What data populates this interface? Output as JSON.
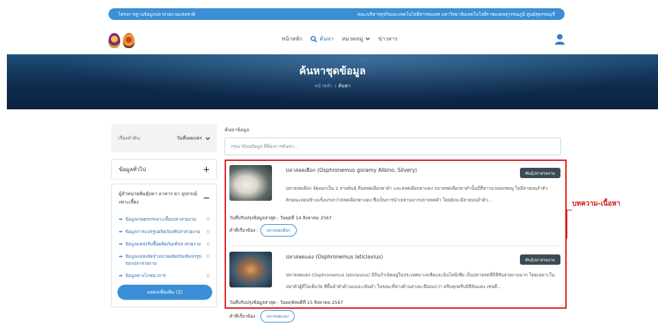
{
  "topbar": {
    "left": "โครงการฐานข้อมูลปลาสวยงามแห่งชาติ",
    "right": "คณะบริหารธุรกิจและเทคโนโลยีสารสนเทศ มหาวิทยาลัยเทคโนโลยีราชมงคลสุวรรณภูมิ ศูนย์สุพรรณบุรี"
  },
  "nav": {
    "home": "หน้าหลัก",
    "search": "ค้นหา",
    "categories": "หมวดหมู่",
    "news": "ข่าวสาร"
  },
  "hero": {
    "title": "ค้นหาชุดข้อมูล",
    "crumb_home": "หน้าหลัก",
    "crumb_sep": "/",
    "crumb_current": "ค้นหา"
  },
  "sidebar": {
    "sort_label": "เรียงลำดับ:",
    "sort_value": "วันที่เผยแพร่",
    "category": "ข้อมูลทั่วไป",
    "category_icon": "plus-icon",
    "supplier_heading": "ผู้จำหน่ายพันธุ์ปลา อาหาร ยา อุปกรณ์เพาะเลี้ยง",
    "links": [
      {
        "label": "ข้อมูลเกษตรกรเพาะเลี้ยงปลาสวยงาม",
        "count": "0"
      },
      {
        "label": "ข้อมูลการแปรรูปผลิตภัณฑ์ปลาสวยงาม",
        "count": "0"
      },
      {
        "label": "ข้อมูลแหล่งรับซื้อผลิตภัณฑ์ปลาสวยงาม",
        "count": "0"
      },
      {
        "label": "ข้อมูลแหล่งจัดจำหน่ายผลิตภัณฑ์แปรรูปของปลาสวยงาม",
        "count": "0"
      },
      {
        "label": "ข้อมูลทางโภชนาการ",
        "count": "0"
      }
    ],
    "more_button": "แสดงเพิ่มเติม (2)"
  },
  "search": {
    "label": "ค้นหาข้อมูล",
    "placeholder": "กรุณาป้อนข้อมูล ที่ต้องการค้นหา..."
  },
  "results": [
    {
      "title": "ปลาสลดเผือก (Osphronemus goramy Albino, Silvery)",
      "badge": "พันธุ์ปลาสวยงาม",
      "desc": "ปลาสลดเผือก จัดออกเป็น 2 สายพันธุ์ คือสลดเผือกตาดำ และสลดเผือกตาแดง ปลาสลดเผือกตาดำนั้นมีสีขาวนวลอมชมพู ไม่มีลายบนลำตัว ลักษณะค่อนข้างแข็งแรงกว่าสลดเผือกตาแดง ซึ่งเป็นการนำเหล่านจากปลาสลดดำ โดยยังจะมีลายบนลำตัว...",
      "updated": "วันที่ปรับปรุงข้อมูลล่าสุด : วันพุธที่ 14 สิงหาคม 2567",
      "tags_label": "คำที่เกี่ยวข้อง :",
      "tag": "ปลาสลดเผือก"
    },
    {
      "title": "ปลาสลดแดง (Osphronemus laticlavius)",
      "badge": "พันธุ์ปลาสวยงาม",
      "desc": "ปลาสลดแดง (Osphronemus laticlavius) มีถิ่นกำเนิดอยู่ในประเทศมาเลเซียและอินโดนีเซีย เป็นปลาสลดที่มีสีสันสวยงามมาก โดยเฉพาะในปลาตัวผู้ที่โตเต็มวัย สีพื้นลำตัวด้านบนจะเข้มดำ ในขณะที่ทางด้านล่างจะสีอ่อนกว่า ครีบทุกครีบมีสีสันแดง เช่นที่...",
      "updated": "วันที่ปรับปรุงข้อมูลล่าสุด : วันพฤหัสบดีที่ 15 สิงหาคม 2567",
      "tags_label": "คำที่เกี่ยวข้อง :",
      "tag": "ปลาสลดแดง"
    }
  ],
  "annotation": {
    "label": "บทความ-เนื้อหา",
    "color": "#e01919"
  },
  "colors": {
    "accent": "#3a8fd6",
    "badge": "#3b4b54"
  }
}
